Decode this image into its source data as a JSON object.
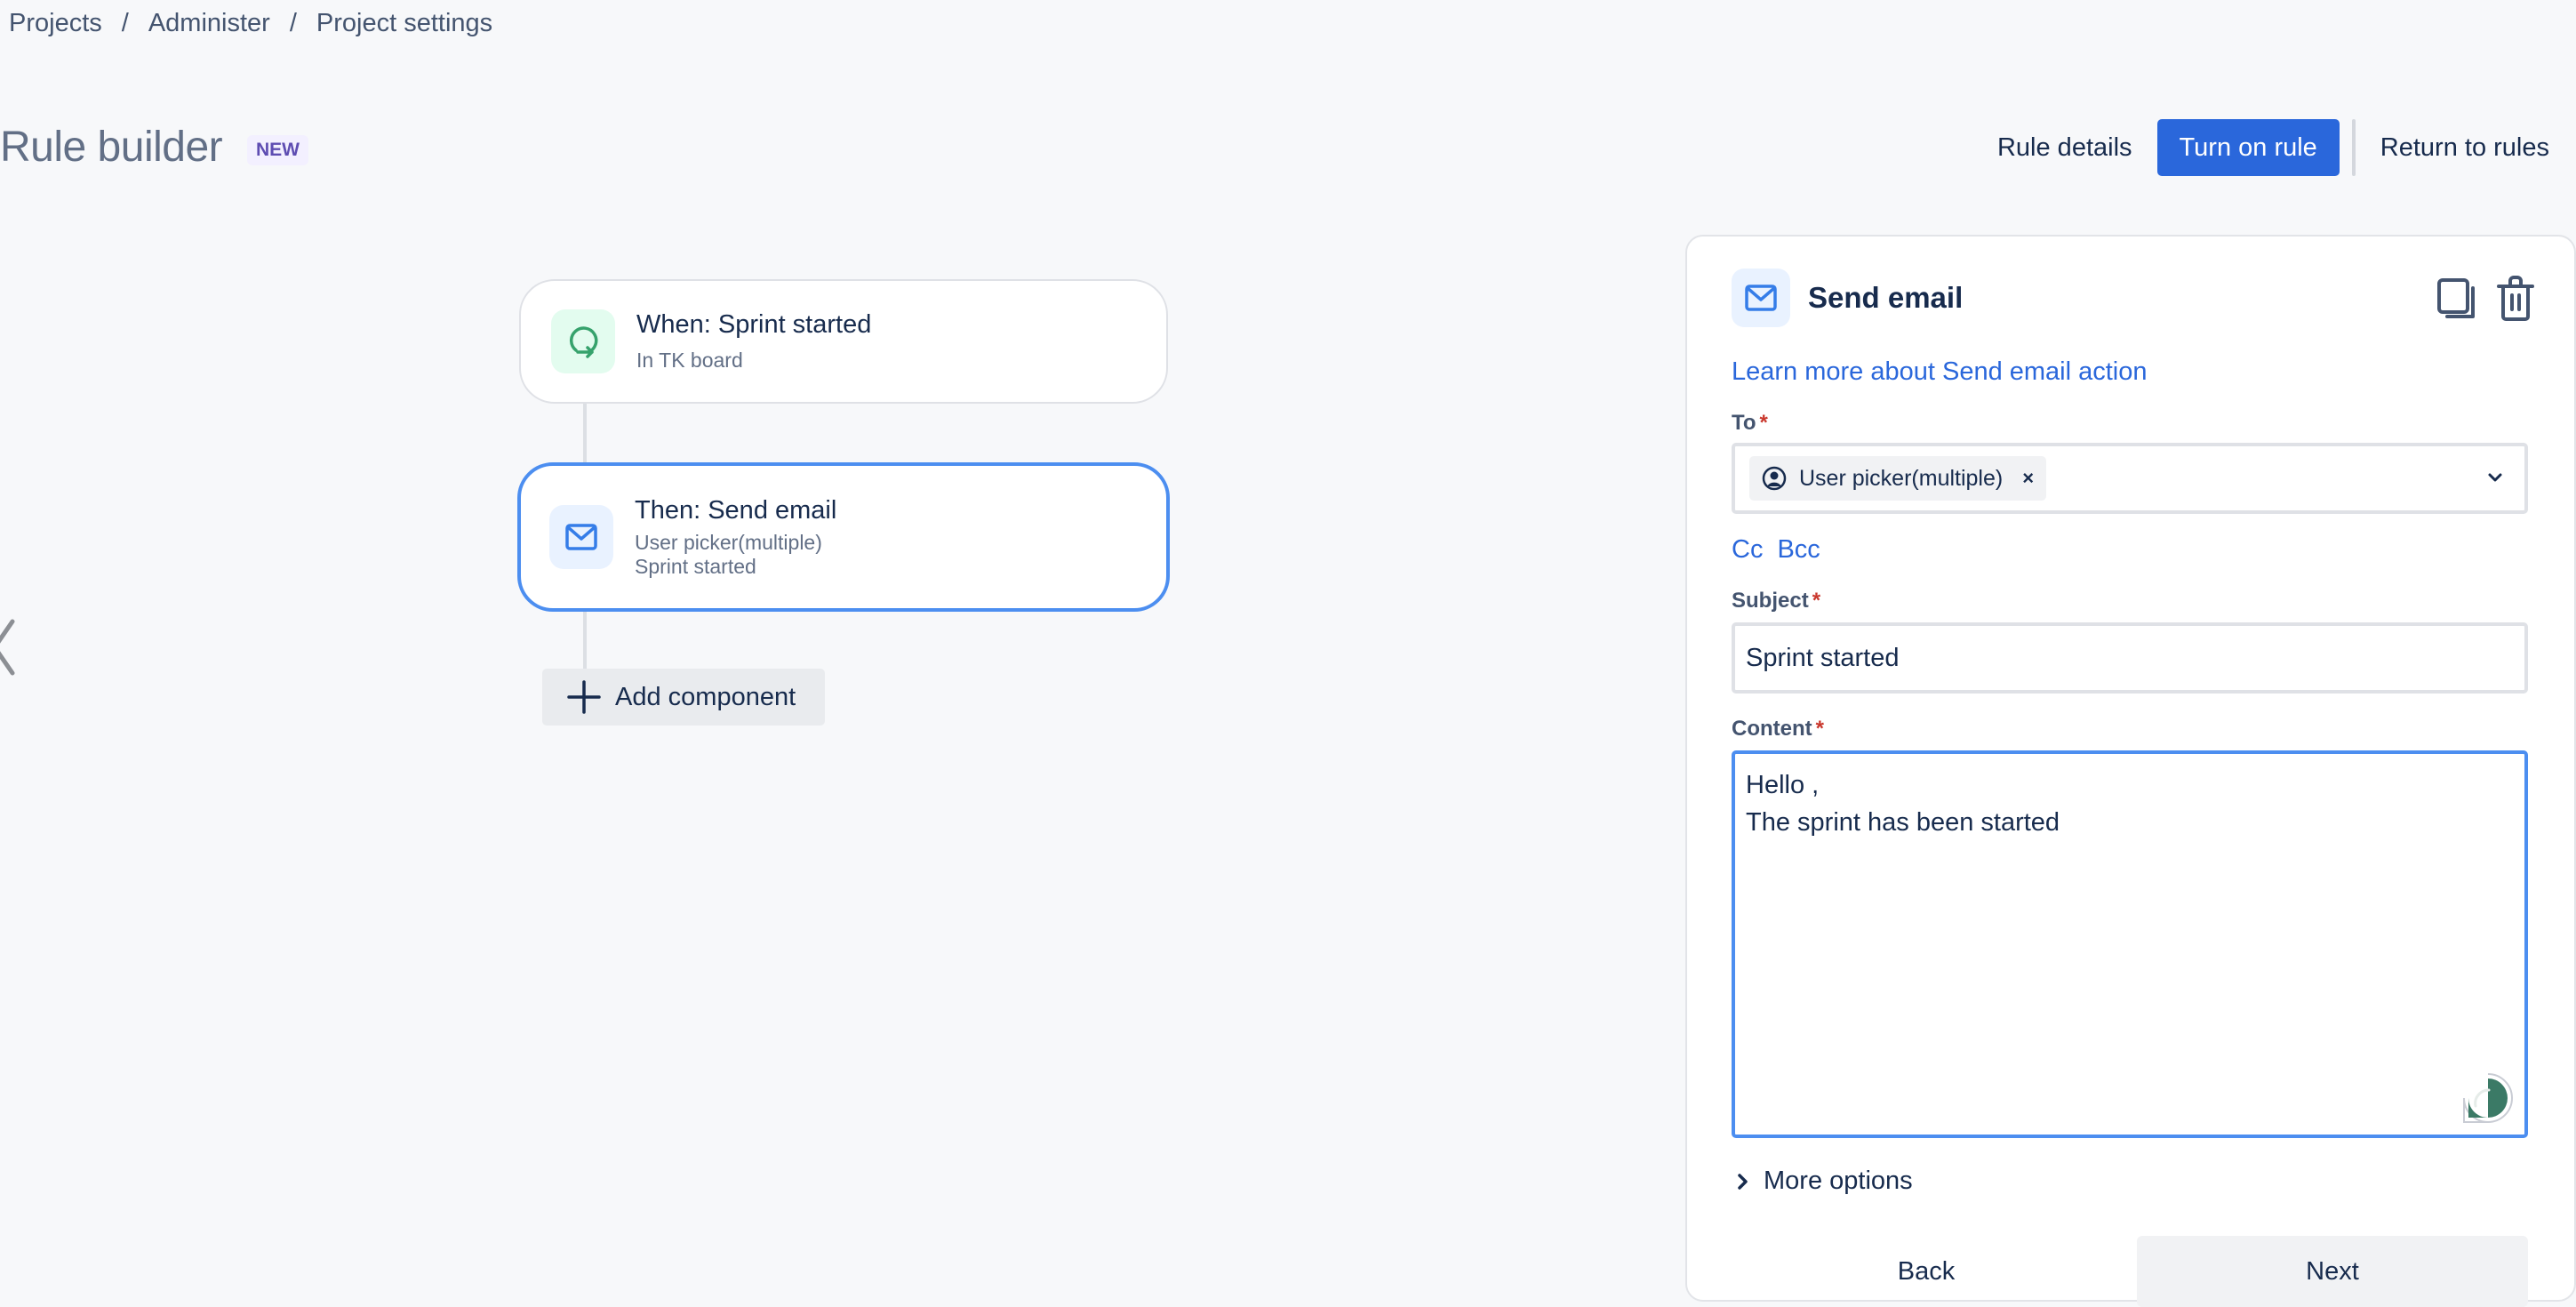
{
  "breadcrumb": [
    "Projects",
    "Administer",
    "Project settings"
  ],
  "breadcrumb_separator": "/",
  "header": {
    "title": "Rule builder",
    "badge": "NEW",
    "rule_details_label": "Rule details",
    "turn_on_label": "Turn on rule",
    "return_label": "Return to rules"
  },
  "flow": {
    "trigger": {
      "icon": "sprint-cycle-icon",
      "title": "When: Sprint started",
      "subtitle": "In TK board"
    },
    "action": {
      "icon": "mail-icon",
      "title": "Then: Send email",
      "subtitle_lines": [
        "User picker(multiple)",
        "Sprint started"
      ]
    },
    "add_component_label": "Add component"
  },
  "panel": {
    "title": "Send email",
    "learn_more_link": "Learn more about Send email action",
    "to": {
      "label": "To",
      "required": "*",
      "chips": [
        {
          "label": "User picker(multiple)",
          "icon": "user-avatar-icon"
        }
      ]
    },
    "cc_label": "Cc",
    "bcc_label": "Bcc",
    "subject": {
      "label": "Subject",
      "required": "*",
      "value": "Sprint started"
    },
    "content": {
      "label": "Content",
      "required": "*",
      "value": "Hello ,\nThe sprint has been started"
    },
    "more_options_label": "More options",
    "back_label": "Back",
    "next_label": "Next"
  },
  "colors": {
    "primary": "#2a67db",
    "selected_border": "#4c8ef0",
    "trigger_icon": "#36a26c",
    "required": "#c9372c",
    "badge_text": "#5e4db2"
  }
}
